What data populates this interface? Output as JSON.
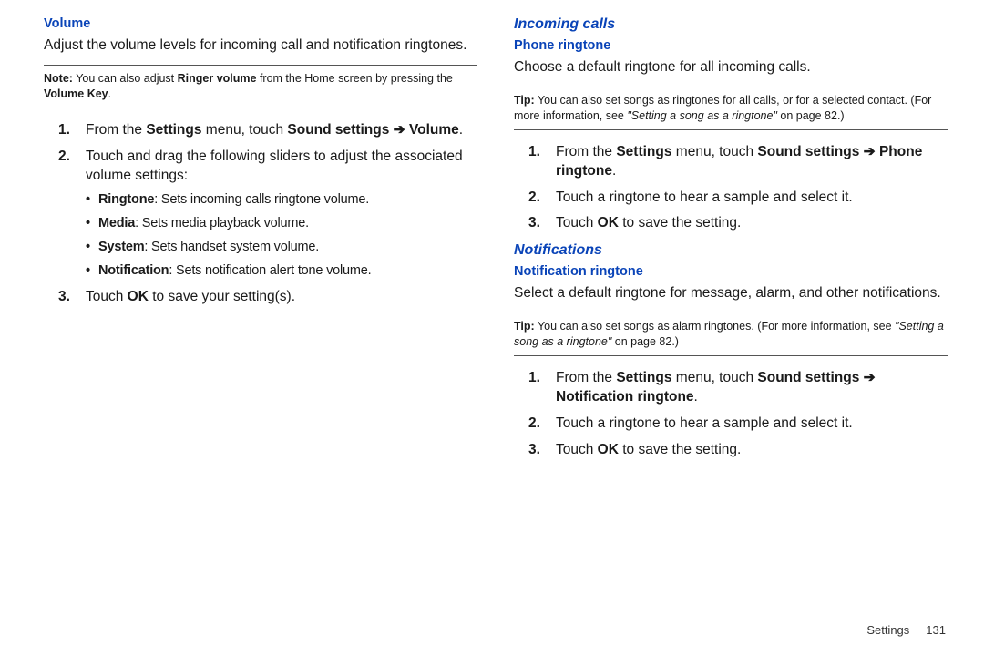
{
  "left": {
    "h_volume": "Volume",
    "intro": "Adjust the volume levels for incoming call and notification ringtones.",
    "note": {
      "label": "Note:",
      "t1": " You can also adjust ",
      "b1": "Ringer volume",
      "t2": " from the Home screen by pressing the ",
      "b2": "Volume Key",
      "t3": "."
    },
    "steps": {
      "s1a": "From the ",
      "s1b": "Settings",
      "s1c": " menu, touch ",
      "s1d": "Sound settings ",
      "s1arrow": "➔",
      "s1e": " Volume",
      "s1f": ".",
      "s2": "Touch and drag the following sliders to adjust the associated volume settings:",
      "s3a": "Touch ",
      "s3b": "OK",
      "s3c": " to save your setting(s)."
    },
    "bullets": {
      "b1a": "Ringtone",
      "b1b": ": Sets incoming calls ringtone volume.",
      "b2a": "Media",
      "b2b": ": Sets media playback volume.",
      "b3a": "System",
      "b3b": ": Sets handset system volume.",
      "b4a": "Notification",
      "b4b": ": Sets notification alert tone volume."
    }
  },
  "right": {
    "h_incoming": "Incoming calls",
    "h_phone_ringtone": "Phone ringtone",
    "intro1": "Choose a default ringtone for all incoming calls.",
    "tip1": {
      "label": "Tip:",
      "t1": " You can also set songs as ringtones for all calls, or for a selected contact. (For more information, see ",
      "i1": "\"Setting a song as a ringtone\"",
      "t2": " on page 82.)"
    },
    "steps1": {
      "s1a": "From the ",
      "s1b": "Settings",
      "s1c": " menu, touch ",
      "s1d": "Sound settings ",
      "s1arrow": "➔",
      "s1e": " Phone ringtone",
      "s1f": ".",
      "s2": "Touch a ringtone to hear a sample and select it.",
      "s3a": "Touch ",
      "s3b": "OK",
      "s3c": " to save the setting."
    },
    "h_notifications": "Notifications",
    "h_notification_ringtone": "Notification ringtone",
    "intro2": "Select a default ringtone for message, alarm, and other notifications.",
    "tip2": {
      "label": "Tip:",
      "t1": " You can also set songs as alarm ringtones. (For more information, see ",
      "i1": "\"Setting a song as a ringtone\"",
      "t2": " on page 82.)"
    },
    "steps2": {
      "s1a": "From the ",
      "s1b": "Settings",
      "s1c": " menu, touch ",
      "s1d": "Sound settings ",
      "s1arrow": "➔",
      "s1e": " Notification ringtone",
      "s1f": ".",
      "s2": "Touch a ringtone to hear a sample and select it.",
      "s3a": "Touch ",
      "s3b": "OK",
      "s3c": " to save the setting."
    }
  },
  "footer": {
    "section": "Settings",
    "page": "131"
  }
}
